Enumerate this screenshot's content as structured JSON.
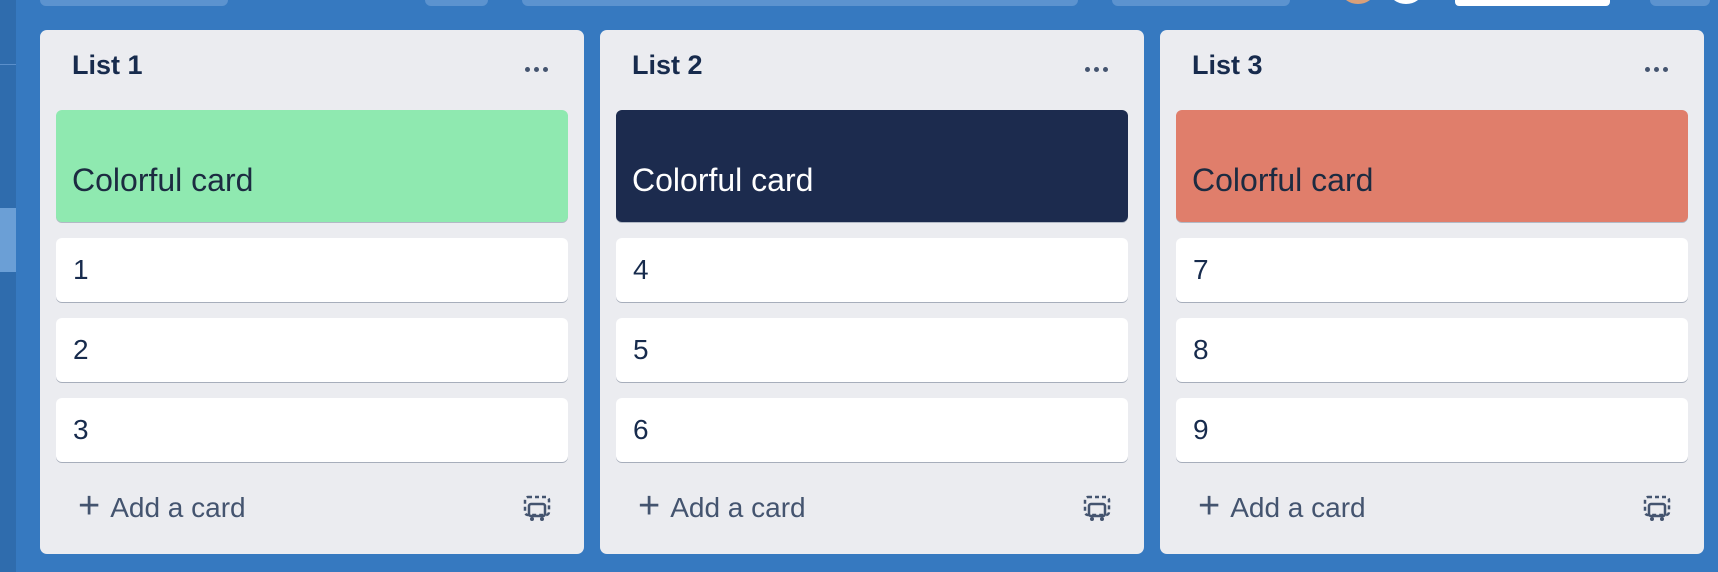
{
  "board": {
    "lists": [
      {
        "title": "List 1",
        "cover_card": {
          "title": "Colorful card",
          "color": "#8fe9b0",
          "text_color": "#1c2b41"
        },
        "cards": [
          "1",
          "2",
          "3"
        ],
        "add_card_label": "Add a card"
      },
      {
        "title": "List 2",
        "cover_card": {
          "title": "Colorful card",
          "color": "#1c2b4e",
          "text_color": "#ffffff"
        },
        "cards": [
          "4",
          "5",
          "6"
        ],
        "add_card_label": "Add a card"
      },
      {
        "title": "List 3",
        "cover_card": {
          "title": "Colorful card",
          "color": "#e07e6b",
          "text_color": "#1c2b41"
        },
        "cards": [
          "7",
          "8",
          "9"
        ],
        "add_card_label": "Add a card"
      }
    ]
  },
  "icons": {
    "list_menu": "more-horizontal-icon",
    "add": "plus-icon",
    "template": "card-template-icon"
  },
  "colors": {
    "board_background": "#3679c0",
    "list_background": "#ebecf0"
  }
}
